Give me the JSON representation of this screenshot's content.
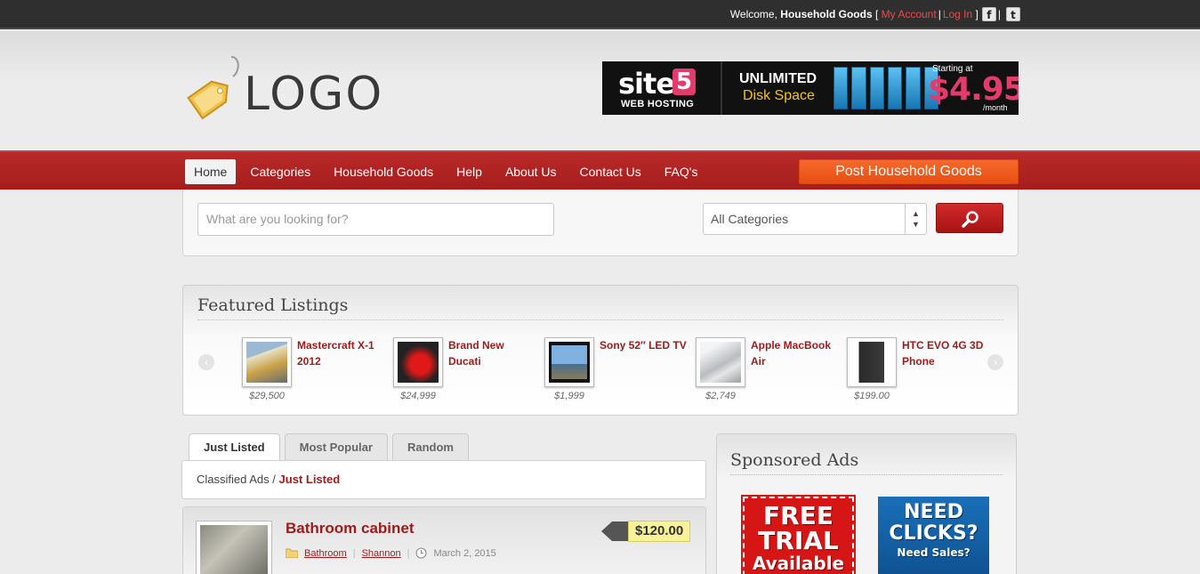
{
  "topbar": {
    "welcome_prefix": "Welcome,",
    "user": "Household Goods",
    "bracket_open": "[",
    "my_account": "My Account",
    "sep": "|",
    "login": "Log In",
    "bracket_close": "]",
    "facebook_icon": "f",
    "twitter_icon": "t"
  },
  "header": {
    "logo_text": "LOGO",
    "banner": {
      "site": "site",
      "five": "5",
      "web_hosting": "WEB HOSTING",
      "unlimited": "UNLIMITED",
      "disk_space": "Disk Space",
      "starting_at": "Starting at",
      "price": "$4.95",
      "per_month": "/month"
    }
  },
  "nav": {
    "items": [
      {
        "label": "Home",
        "active": true
      },
      {
        "label": "Categories"
      },
      {
        "label": "Household Goods"
      },
      {
        "label": "Help"
      },
      {
        "label": "About Us"
      },
      {
        "label": "Contact Us"
      },
      {
        "label": "FAQ's"
      }
    ],
    "post_button": "Post Household Goods"
  },
  "search": {
    "placeholder": "What are you looking for?",
    "category_selected": "All Categories"
  },
  "featured": {
    "title": "Featured Listings",
    "items": [
      {
        "name": "Mastercraft X-1 2012",
        "price": "$29,500"
      },
      {
        "name": "Brand New Ducati",
        "price": "$24,999"
      },
      {
        "name": "Sony 52″ LED TV",
        "price": "$1,999"
      },
      {
        "name": "Apple MacBook Air",
        "price": "$2,749"
      },
      {
        "name": "HTC EVO 4G 3D Phone",
        "price": "$199.00"
      }
    ]
  },
  "tabs": [
    {
      "label": "Just Listed",
      "active": true
    },
    {
      "label": "Most Popular"
    },
    {
      "label": "Random"
    }
  ],
  "breadcrumb": {
    "root": "Classified Ads",
    "sep": "/",
    "current": "Just Listed"
  },
  "listing": {
    "title": "Bathroom cabinet",
    "price": "$120.00",
    "category": "Bathroom",
    "author": "Shannon",
    "date": "March 2, 2015"
  },
  "sponsored": {
    "title": "Sponsored Ads",
    "ad1": {
      "line1": "FREE",
      "line2": "TRIAL",
      "line3": "Available"
    },
    "ad2": {
      "line1": "NEED",
      "line2": "CLICKS?",
      "line3": "Need Sales?"
    }
  },
  "colors": {
    "accent_red": "#a61c1c",
    "post_orange": "#e84e12",
    "link_red": "#9e1b1b"
  }
}
